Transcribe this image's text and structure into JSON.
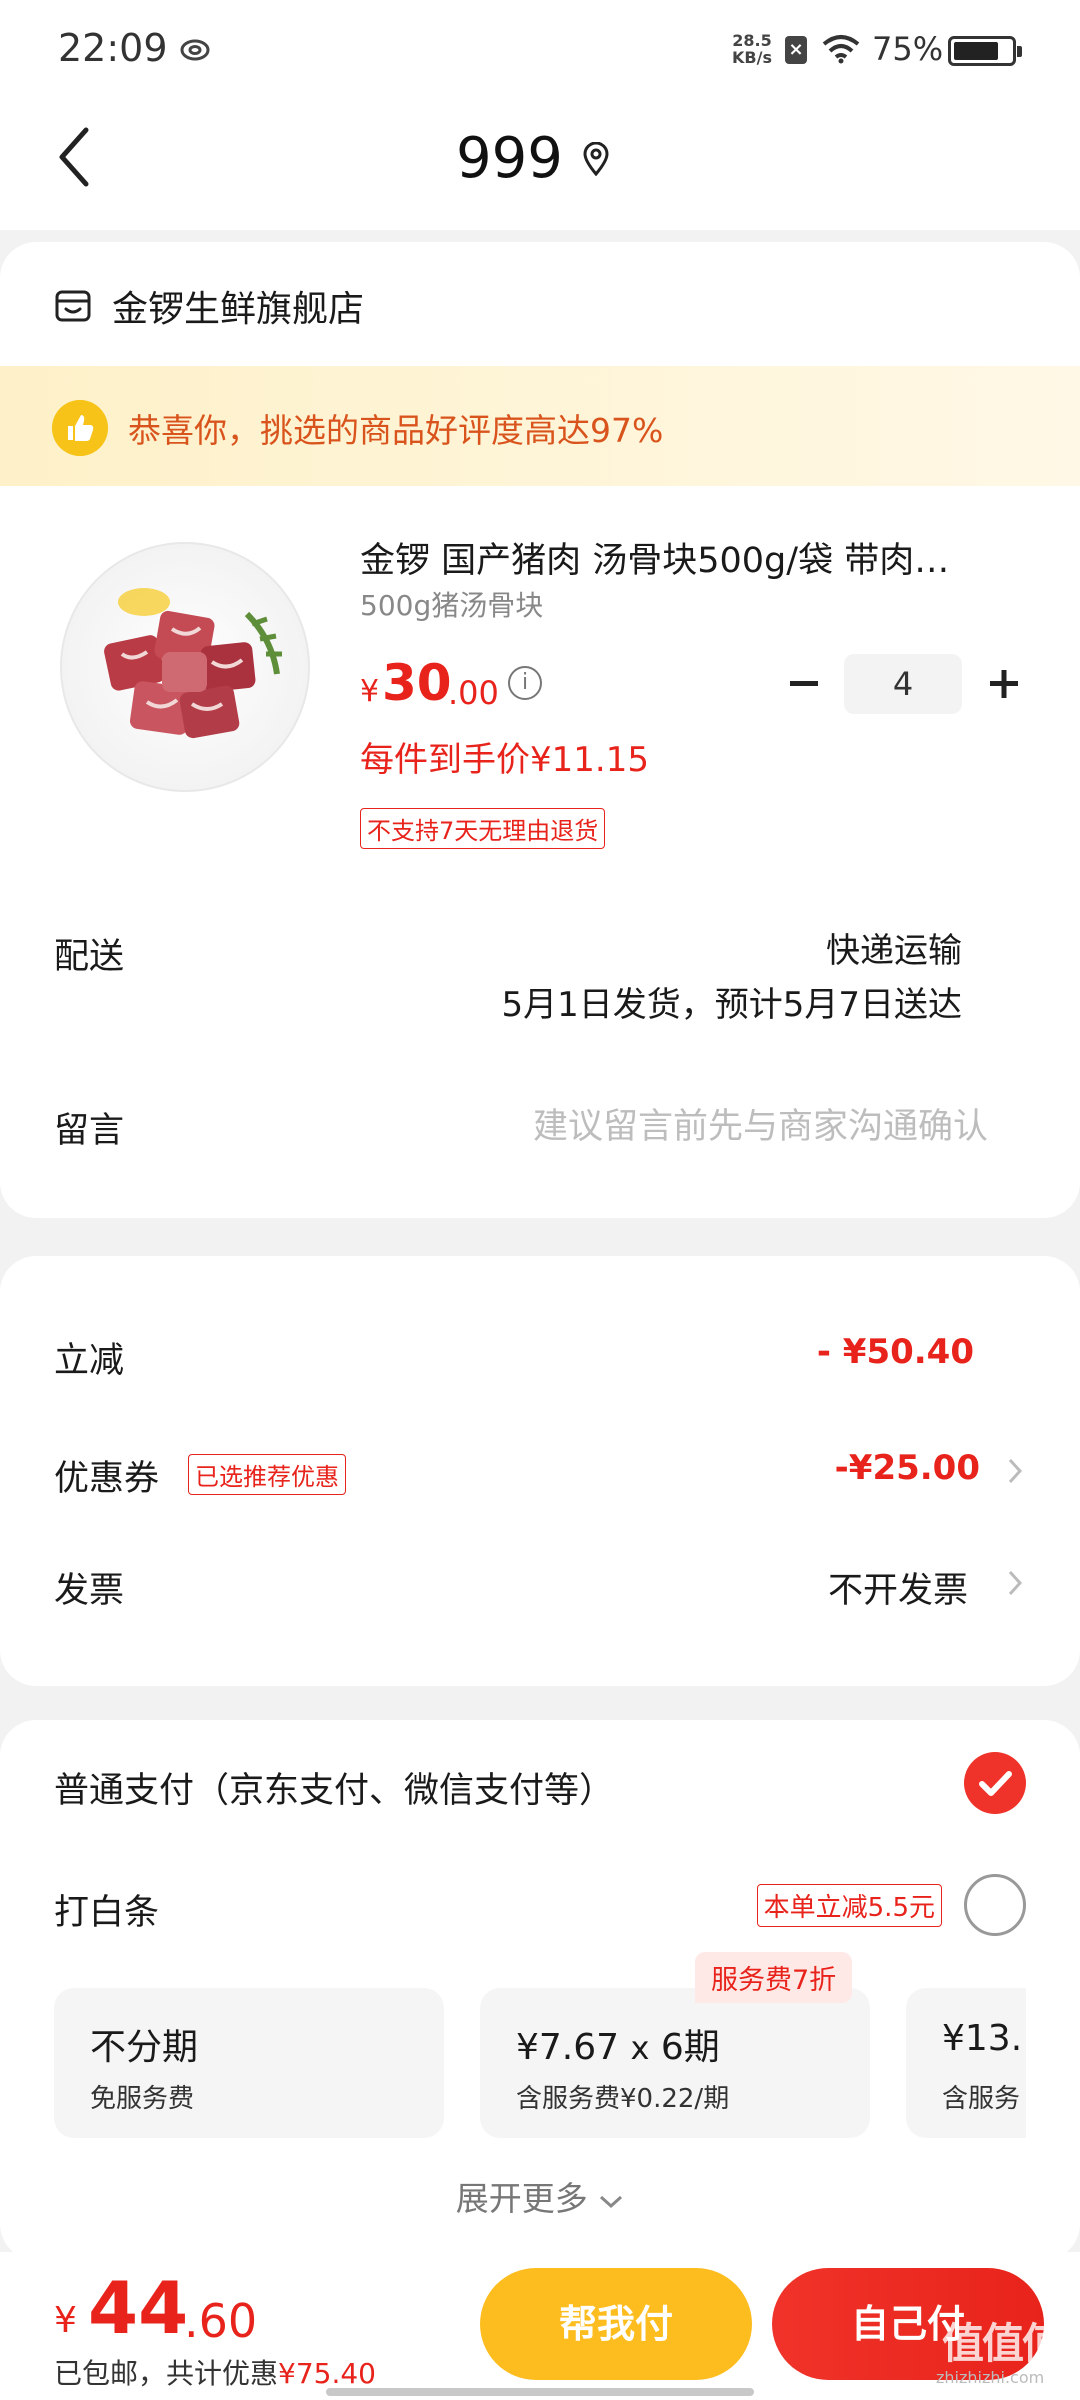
{
  "status_bar": {
    "time": "22:09",
    "net_speed_value": "28.5",
    "net_speed_unit": "KB/s",
    "battery": "75%"
  },
  "nav": {
    "title": "999"
  },
  "shop": {
    "name": "金锣生鲜旗舰店"
  },
  "praise": {
    "text": "恭喜你，挑选的商品好评度高达97%"
  },
  "product": {
    "title": "金锣 国产猪肉 汤骨块500g/袋 带肉…",
    "spec": "500g猪汤骨块",
    "price_symbol": "¥",
    "price_int": "30",
    "price_dec": ".00",
    "quantity": "4",
    "final_price": "每件到手价¥11.15",
    "return_policy": "不支持7天无理由退货"
  },
  "delivery": {
    "label": "配送",
    "type": "快递运输",
    "date": "5月1日发货，预计5月7日送达"
  },
  "message": {
    "label": "留言",
    "placeholder": "建议留言前先与商家沟通确认"
  },
  "discounts": {
    "instant_label": "立减",
    "instant_value": "- ¥50.40",
    "coupon_label": "优惠券",
    "coupon_tag": "已选推荐优惠",
    "coupon_value": "-¥25.00",
    "invoice_label": "发票",
    "invoice_value": "不开发票"
  },
  "payment": {
    "normal_label": "普通支付（京东支付、微信支付等）",
    "baitiao_label": "打白条",
    "baitiao_tag": "本单立减5.5元",
    "installments": [
      {
        "main": "不分期",
        "sub": "免服务费"
      },
      {
        "main_value": "¥7.67",
        "main_x": "x",
        "main_period": "6期",
        "sub": "含服务费¥0.22/期"
      },
      {
        "main": "¥13.",
        "sub": "含服务"
      }
    ],
    "install_badge": "服务费7折",
    "expand": "展开更多"
  },
  "bottom": {
    "total_symbol": "¥",
    "total_int": "44",
    "total_dec": ".60",
    "note_prefix": "已包邮，共计优惠",
    "note_value": "¥75.40",
    "help_pay": "帮我付",
    "self_pay": "自己付",
    "watermark": "值值值",
    "watermark_sub": "zhizhizhi.com"
  },
  "colors": {
    "accent": "#e8231b",
    "yellow_button": "#fdbd1f",
    "praise_text": "#d9541d"
  }
}
